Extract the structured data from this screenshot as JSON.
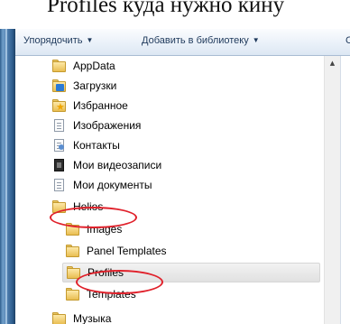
{
  "caption": "Profiles куда нужно кину",
  "toolbar": {
    "organize_label": "Упорядочить",
    "add_to_library_label": "Добавить в библиотеку",
    "overflow_label": "С"
  },
  "tree": {
    "items": [
      {
        "label": "AppData",
        "icon": "folder-icon"
      },
      {
        "label": "Загрузки",
        "icon": "downloads-folder-icon"
      },
      {
        "label": "Избранное",
        "icon": "favorites-folder-icon"
      },
      {
        "label": "Изображения",
        "icon": "documents-icon"
      },
      {
        "label": "Контакты",
        "icon": "contacts-icon"
      },
      {
        "label": "Мои видеозаписи",
        "icon": "videos-icon"
      },
      {
        "label": "Мои документы",
        "icon": "documents-icon"
      },
      {
        "label": "Helios",
        "icon": "folder-icon",
        "annotated": true
      },
      {
        "label": "Images",
        "icon": "folder-icon"
      },
      {
        "label": "Panel Templates",
        "icon": "folder-icon"
      },
      {
        "label": "Profiles",
        "icon": "folder-icon",
        "selected": true,
        "annotated": true
      },
      {
        "label": "Templates",
        "icon": "folder-icon"
      },
      {
        "label": "Музыка",
        "icon": "folder-icon"
      }
    ]
  },
  "colors": {
    "annotation": "#e0202a",
    "toolbar_text": "#1e395b",
    "frame": "#2d5c8c"
  }
}
